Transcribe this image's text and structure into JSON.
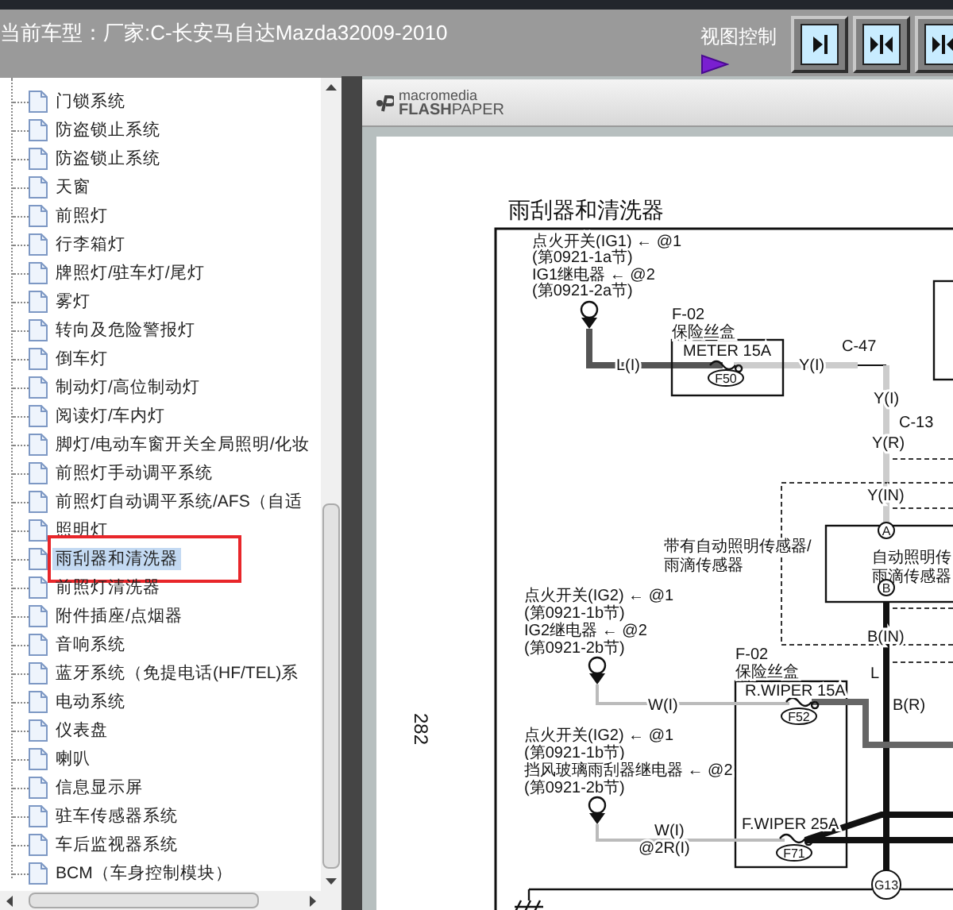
{
  "header": {
    "title": "当前车型：厂家:C-长安马自达Mazda32009-2010",
    "view_control": {
      "label": "视图控制"
    }
  },
  "sidebar": {
    "items": [
      {
        "label": "门锁系统",
        "selected": false
      },
      {
        "label": "防盗锁止系统",
        "selected": false
      },
      {
        "label": "防盗锁止系统",
        "selected": false
      },
      {
        "label": "天窗",
        "selected": false
      },
      {
        "label": "前照灯",
        "selected": false
      },
      {
        "label": "行李箱灯",
        "selected": false
      },
      {
        "label": "牌照灯/驻车灯/尾灯",
        "selected": false
      },
      {
        "label": "雾灯",
        "selected": false
      },
      {
        "label": "转向及危险警报灯",
        "selected": false
      },
      {
        "label": "倒车灯",
        "selected": false
      },
      {
        "label": "制动灯/高位制动灯",
        "selected": false
      },
      {
        "label": "阅读灯/车内灯",
        "selected": false
      },
      {
        "label": "脚灯/电动车窗开关全局照明/化妆",
        "selected": false
      },
      {
        "label": "前照灯手动调平系统",
        "selected": false
      },
      {
        "label": "前照灯自动调平系统/AFS（自适",
        "selected": false
      },
      {
        "label": "照明灯",
        "selected": false
      },
      {
        "label": "雨刮器和清洗器",
        "selected": true
      },
      {
        "label": "前照灯清洗器",
        "selected": false
      },
      {
        "label": "附件插座/点烟器",
        "selected": false
      },
      {
        "label": "音响系统",
        "selected": false
      },
      {
        "label": "蓝牙系统（免提电话(HF/TEL)系",
        "selected": false
      },
      {
        "label": "电动系统",
        "selected": false
      },
      {
        "label": "仪表盘",
        "selected": false
      },
      {
        "label": "喇叭",
        "selected": false
      },
      {
        "label": "信息显示屏",
        "selected": false
      },
      {
        "label": "驻车传感器系统",
        "selected": false
      },
      {
        "label": "车后监视器系统",
        "selected": false
      },
      {
        "label": "BCM（车身控制模块）",
        "selected": false
      }
    ]
  },
  "viewer": {
    "brand_top": "macromedia",
    "brand": "**FLASH**PAPER",
    "page": {
      "title": "雨刮器和清洗器",
      "page_number": "282",
      "diagram": {
        "labels": [
          {
            "kind": "text",
            "text": "点火开关(IG1) ← @1"
          },
          {
            "kind": "text",
            "text": "(第0921-1a节)"
          },
          {
            "kind": "text",
            "text": "IG1继电器 ← @2"
          },
          {
            "kind": "text",
            "text": "(第0921-2a节)"
          },
          {
            "kind": "text",
            "text": "F-02"
          },
          {
            "kind": "text",
            "text": "保险丝盒"
          },
          {
            "kind": "text",
            "text": "METER 15A"
          },
          {
            "kind": "text",
            "text": "L(I)"
          },
          {
            "kind": "oval",
            "text": "F50"
          },
          {
            "kind": "text",
            "text": "Y(I)"
          },
          {
            "kind": "text",
            "text": "C-47"
          },
          {
            "kind": "text",
            "text": "Y(I)"
          },
          {
            "kind": "text",
            "text": "C-13"
          },
          {
            "kind": "text",
            "text": "Y(R)"
          },
          {
            "kind": "text",
            "text": "Y(IN)"
          },
          {
            "kind": "text",
            "text": "带有自动照明传感器/"
          },
          {
            "kind": "text",
            "text": "雨滴传感器"
          },
          {
            "kind": "circle",
            "text": "A"
          },
          {
            "kind": "text",
            "text": "自动照明传"
          },
          {
            "kind": "text",
            "text": "雨滴传感器"
          },
          {
            "kind": "circle",
            "text": "B"
          },
          {
            "kind": "text",
            "text": "点火开关(IG2) ← @1"
          },
          {
            "kind": "text",
            "text": "(第0921-1b节)"
          },
          {
            "kind": "text",
            "text": "IG2继电器 ← @2"
          },
          {
            "kind": "text",
            "text": "(第0921-2b节)"
          },
          {
            "kind": "text",
            "text": "B(IN)"
          },
          {
            "kind": "text",
            "text": "F-02"
          },
          {
            "kind": "text",
            "text": "保险丝盒"
          },
          {
            "kind": "text",
            "text": "L"
          },
          {
            "kind": "text",
            "text": "R.WIPER 15A"
          },
          {
            "kind": "text",
            "text": "B(R)"
          },
          {
            "kind": "oval",
            "text": "F52"
          },
          {
            "kind": "text",
            "text": "W(I)"
          },
          {
            "kind": "text",
            "text": "点火开关(IG2) ← @1"
          },
          {
            "kind": "text",
            "text": "(第0921-1b节)"
          },
          {
            "kind": "text",
            "text": "挡风玻璃雨刮器继电器 ← @2"
          },
          {
            "kind": "text",
            "text": "(第0921-2b节)"
          },
          {
            "kind": "text",
            "text": "F.WIPER 25A"
          },
          {
            "kind": "text",
            "text": "W(I)"
          },
          {
            "kind": "text",
            "text": "@2R(I)"
          },
          {
            "kind": "oval",
            "text": "F71"
          },
          {
            "kind": "circle",
            "text": "G13"
          }
        ]
      }
    }
  }
}
